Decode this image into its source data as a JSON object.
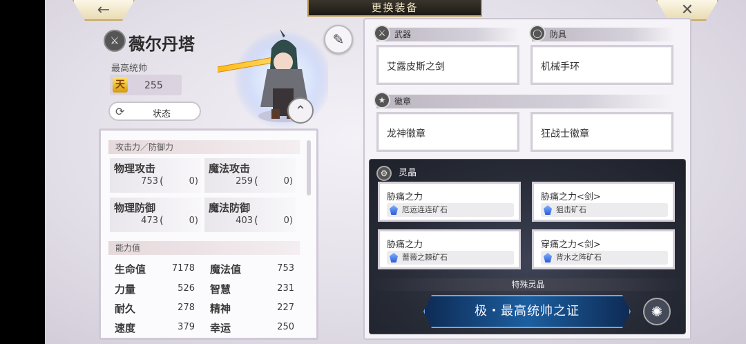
{
  "top_bar": {
    "back_icon": "back-arrow-icon",
    "title": "更换装备",
    "close_icon": "close-icon"
  },
  "character": {
    "name": "薇尔丹塔",
    "title": "最高统帅",
    "rank_badge": "天",
    "rank_value": "255",
    "status_button": "状态"
  },
  "stats": {
    "atk_def_header": "攻击力／防御力",
    "cells": [
      {
        "name": "物理攻击",
        "value": "753",
        "open": "(",
        "bonus": "0)"
      },
      {
        "name": "魔法攻击",
        "value": "259",
        "open": "(",
        "bonus": "0)"
      },
      {
        "name": "物理防御",
        "value": "473",
        "open": "(",
        "bonus": "0)"
      },
      {
        "name": "魔法防御",
        "value": "403",
        "open": "(",
        "bonus": "0)"
      }
    ],
    "ability_header": "能力值",
    "abilities": [
      {
        "k": "生命值",
        "v": "7178"
      },
      {
        "k": "魔法值",
        "v": "753"
      },
      {
        "k": "力量",
        "v": "526"
      },
      {
        "k": "智慧",
        "v": "231"
      },
      {
        "k": "耐久",
        "v": "278"
      },
      {
        "k": "精神",
        "v": "227"
      },
      {
        "k": "速度",
        "v": "379"
      },
      {
        "k": "幸运",
        "v": "250"
      }
    ]
  },
  "equipment": {
    "weapon_label": "武器",
    "armor_label": "防具",
    "badge_label": "徽章",
    "weapon": "艾露皮斯之剑",
    "armor": "机械手环",
    "badge1": "龙神徽章",
    "badge2": "狂战士徽章"
  },
  "crystals": {
    "label": "灵晶",
    "slots": [
      {
        "name": "胁痛之力",
        "ore": "厄运连连矿石"
      },
      {
        "name": "胁痛之力<剑>",
        "ore": "狙击矿石"
      },
      {
        "name": "胁痛之力",
        "ore": "蔷薇之棘矿石"
      },
      {
        "name": "穿痛之力<剑>",
        "ore": "背水之阵矿石"
      }
    ],
    "special_label": "特殊灵晶",
    "special_button": "极・最高统帅之证"
  }
}
